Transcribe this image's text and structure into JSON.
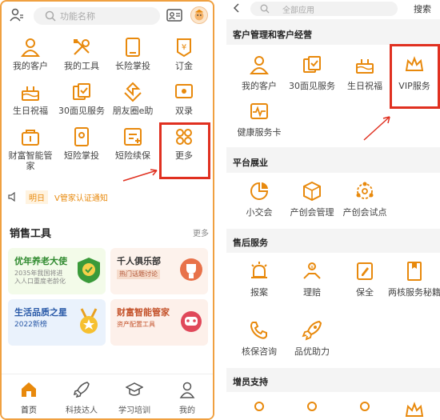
{
  "colors": {
    "accent": "#e8890c",
    "highlight_box": "#e03020",
    "panel_border": "#f0a040"
  },
  "left": {
    "search_placeholder": "功能名称",
    "grid": [
      {
        "label": "我的客户",
        "icon": "person-icon"
      },
      {
        "label": "我的工具",
        "icon": "tools-icon"
      },
      {
        "label": "长险掌投",
        "icon": "tablet-icon"
      },
      {
        "label": "订金",
        "icon": "yen-icon"
      },
      {
        "label": "生日祝福",
        "icon": "cake-icon"
      },
      {
        "label": "30面见服务",
        "icon": "meeting-icon"
      },
      {
        "label": "朋友圈e助",
        "icon": "share-icon"
      },
      {
        "label": "双录",
        "icon": "record-icon"
      },
      {
        "label": "财富智能管家",
        "icon": "wealth-icon"
      },
      {
        "label": "短险掌投",
        "icon": "phone-icon"
      },
      {
        "label": "短险续保",
        "icon": "renew-icon"
      },
      {
        "label": "更多",
        "icon": "more-icon"
      }
    ],
    "notice": {
      "tag": "明日",
      "message": "V管家认证通知"
    },
    "tools_section": {
      "title": "销售工具",
      "more": "更多"
    },
    "tool_cards": [
      {
        "title": "优年养老大使",
        "subtitle": "2035年我国将进\n入人口重度老龄化",
        "title_color": "#2f8a2f"
      },
      {
        "title": "千人俱乐部",
        "subtitle": "热门话题讨论",
        "title_color": "#222222"
      },
      {
        "title": "生活品质之星",
        "subtitle": "2022新榜",
        "title_color": "#2a5aa8"
      },
      {
        "title": "财富智能管家",
        "subtitle": "资产配置工具",
        "title_color": "#c4522a"
      }
    ],
    "tabs": [
      {
        "label": "首页",
        "icon": "home-icon"
      },
      {
        "label": "科技达人",
        "icon": "rocket-icon"
      },
      {
        "label": "学习培训",
        "icon": "graduation-icon"
      },
      {
        "label": "我的",
        "icon": "user-icon"
      }
    ]
  },
  "right": {
    "search_placeholder": "全部应用",
    "search_button": "搜索",
    "sections": [
      {
        "title": "客户管理和客户经营",
        "items": [
          {
            "label": "我的客户",
            "icon": "person-icon"
          },
          {
            "label": "30面见服务",
            "icon": "meeting-icon"
          },
          {
            "label": "生日祝福",
            "icon": "cake-icon"
          },
          {
            "label": "VIP服务",
            "icon": "crown-icon"
          },
          {
            "label": "健康服务卡",
            "icon": "health-icon"
          }
        ]
      },
      {
        "title": "平台展业",
        "items": [
          {
            "label": "小交会",
            "icon": "pie-icon"
          },
          {
            "label": "产创会管理",
            "icon": "cube-icon"
          },
          {
            "label": "产创会试点",
            "icon": "network-icon"
          }
        ]
      },
      {
        "title": "售后服务",
        "items": [
          {
            "label": "报案",
            "icon": "alarm-icon"
          },
          {
            "label": "理赔",
            "icon": "claim-icon"
          },
          {
            "label": "保全",
            "icon": "edit-icon"
          },
          {
            "label": "两核服务秘籍",
            "icon": "book-icon"
          },
          {
            "label": "核保咨询",
            "icon": "phone-call-icon"
          },
          {
            "label": "品优助力",
            "icon": "rocket-icon"
          }
        ]
      },
      {
        "title": "增员支持",
        "items": []
      }
    ]
  }
}
